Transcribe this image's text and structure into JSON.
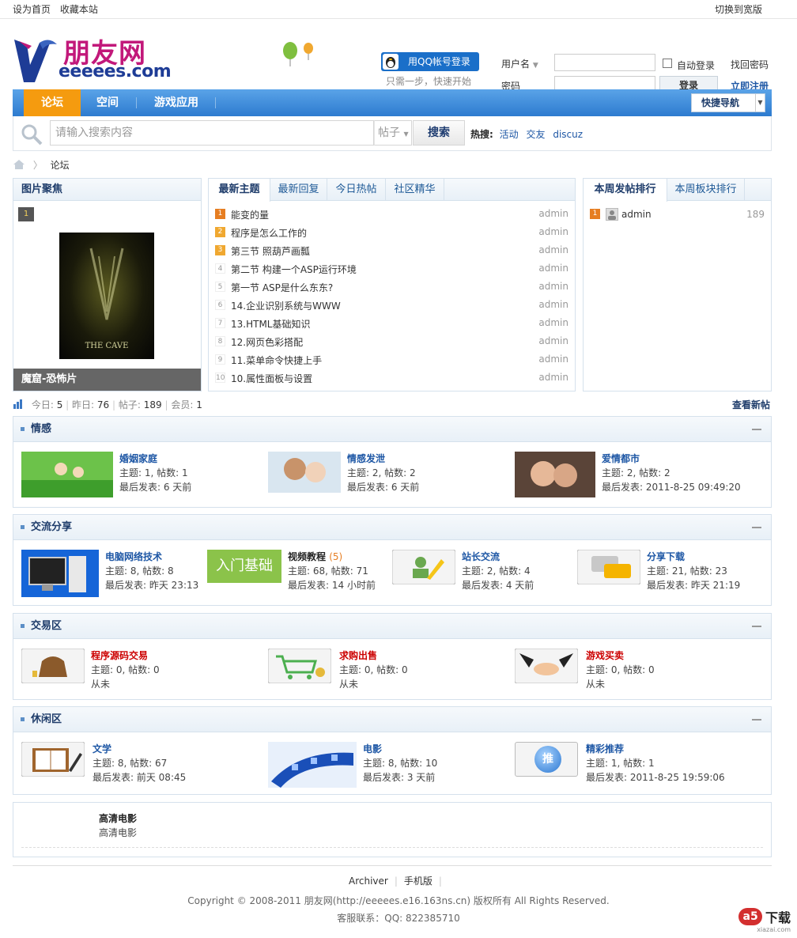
{
  "topbar": {
    "set_home": "设为首页",
    "bookmark": "收藏本站",
    "switch_wide": "切换到宽版"
  },
  "logo": {
    "cn": "朋友网",
    "en": "eeeees.com"
  },
  "qq": {
    "button": "用QQ帐号登录",
    "sub": "只需一步，快速开始"
  },
  "login": {
    "username_label": "用户名",
    "password_label": "密码",
    "auto_login": "自动登录",
    "forgot": "找回密码",
    "submit": "登录",
    "register": "立即注册"
  },
  "nav": {
    "items": [
      "论坛",
      "空间",
      "游戏应用"
    ],
    "quick_nav": "快捷导航"
  },
  "search": {
    "placeholder": "请输入搜索内容",
    "category": "帖子",
    "button": "搜索",
    "hot_label": "热搜:",
    "hot": [
      "活动",
      "交友",
      "discuz"
    ]
  },
  "breadcrumb": {
    "current": "论坛"
  },
  "focus": {
    "title": "图片聚焦",
    "index": "1",
    "caption": "魔窟-恐怖片",
    "poster_text": "THE CAVE"
  },
  "topics_panel": {
    "tabs": [
      "最新主题",
      "最新回复",
      "今日热帖",
      "社区精华"
    ],
    "items": [
      {
        "rank": "1",
        "title": "能变的量",
        "author": "admin"
      },
      {
        "rank": "2",
        "title": "程序是怎么工作的",
        "author": "admin"
      },
      {
        "rank": "3",
        "title": "第三节  照葫芦画瓢",
        "author": "admin"
      },
      {
        "rank": "4",
        "title": "第二节  构建一个ASP运行环境",
        "author": "admin"
      },
      {
        "rank": "5",
        "title": "第一节  ASP是什么东东?",
        "author": "admin"
      },
      {
        "rank": "6",
        "title": "14.企业识别系统与WWW",
        "author": "admin"
      },
      {
        "rank": "7",
        "title": "13.HTML基础知识",
        "author": "admin"
      },
      {
        "rank": "8",
        "title": "12.网页色彩搭配",
        "author": "admin"
      },
      {
        "rank": "9",
        "title": "11.菜单命令快捷上手",
        "author": "admin"
      },
      {
        "rank": "10",
        "title": "10.属性面板与设置",
        "author": "admin"
      }
    ]
  },
  "rank_panel": {
    "tabs": [
      "本周发帖排行",
      "本周板块排行"
    ],
    "items": [
      {
        "rank": "1",
        "user": "admin",
        "count": "189"
      }
    ]
  },
  "stats": {
    "today_label": "今日:",
    "today": "5",
    "yesterday_label": "昨日:",
    "yesterday": "76",
    "posts_label": "帖子:",
    "posts": "189",
    "members_label": "会员:",
    "members": "1",
    "new_posts": "查看新帖"
  },
  "categories": [
    {
      "title": "情感",
      "forums": [
        {
          "name": "婚姻家庭",
          "l1": "主题: 1, 帖数: 1",
          "l2": "最后发表: 6 天前"
        },
        {
          "name": "情感发泄",
          "l1": "主题: 2, 帖数: 2",
          "l2": "最后发表: 6 天前"
        },
        {
          "name": "爱情都市",
          "l1": "主题: 2, 帖数: 2",
          "l2": "最后发表: 2011-8-25 09:49:20"
        }
      ]
    },
    {
      "title": "交流分享",
      "forums": [
        {
          "name": "电脑网络技术",
          "l1": "主题: 8, 帖数: 8",
          "l2": "最后发表: 昨天 23:13"
        },
        {
          "name": "视频教程",
          "extra": "(5)",
          "l1": "主题: 68, 帖数: 71",
          "l2": "最后发表: 14 小时前",
          "thumb_text": "入门基础"
        },
        {
          "name": "站长交流",
          "l1": "主题: 2, 帖数: 4",
          "l2": "最后发表: 4 天前"
        },
        {
          "name": "分享下载",
          "l1": "主题: 21, 帖数: 23",
          "l2": "最后发表: 昨天 21:19"
        }
      ]
    },
    {
      "title": "交易区",
      "forums": [
        {
          "name": "程序源码交易",
          "l1": "主题: 0, 帖数: 0",
          "l2": "从未"
        },
        {
          "name": "求购出售",
          "l1": "主题: 0, 帖数: 0",
          "l2": "从未"
        },
        {
          "name": "游戏买卖",
          "l1": "主题: 0, 帖数: 0",
          "l2": "从未"
        }
      ]
    },
    {
      "title": "休闲区",
      "forums": [
        {
          "name": "文学",
          "l1": "主题: 8, 帖数: 67",
          "l2": "最后发表: 前天 08:45"
        },
        {
          "name": "电影",
          "l1": "主题: 8, 帖数: 10",
          "l2": "最后发表: 3 天前"
        },
        {
          "name": "精彩推荐",
          "l1": "主题: 1, 帖数: 1",
          "l2": "最后发表: 2011-8-25 19:59:06",
          "thumb_text": "推"
        }
      ]
    }
  ],
  "hd": {
    "title": "高清电影",
    "sub": "高清电影"
  },
  "footer": {
    "archiver": "Archiver",
    "mobile": "手机版",
    "copyright": "Copyright © 2008-2011 朋友网(http://eeeees.e16.163ns.cn) 版权所有  All Rights Reserved.",
    "service": "客服联系：QQ: 822385710",
    "watermark": "下载",
    "watermark_url": "xiazai.com",
    "watermark_mark": "a5"
  },
  "colors": {
    "nav_blue": "#2d7bcf",
    "nav_active": "#f59b0f",
    "link_blue": "#1e57a5",
    "red": "#cc0000"
  }
}
